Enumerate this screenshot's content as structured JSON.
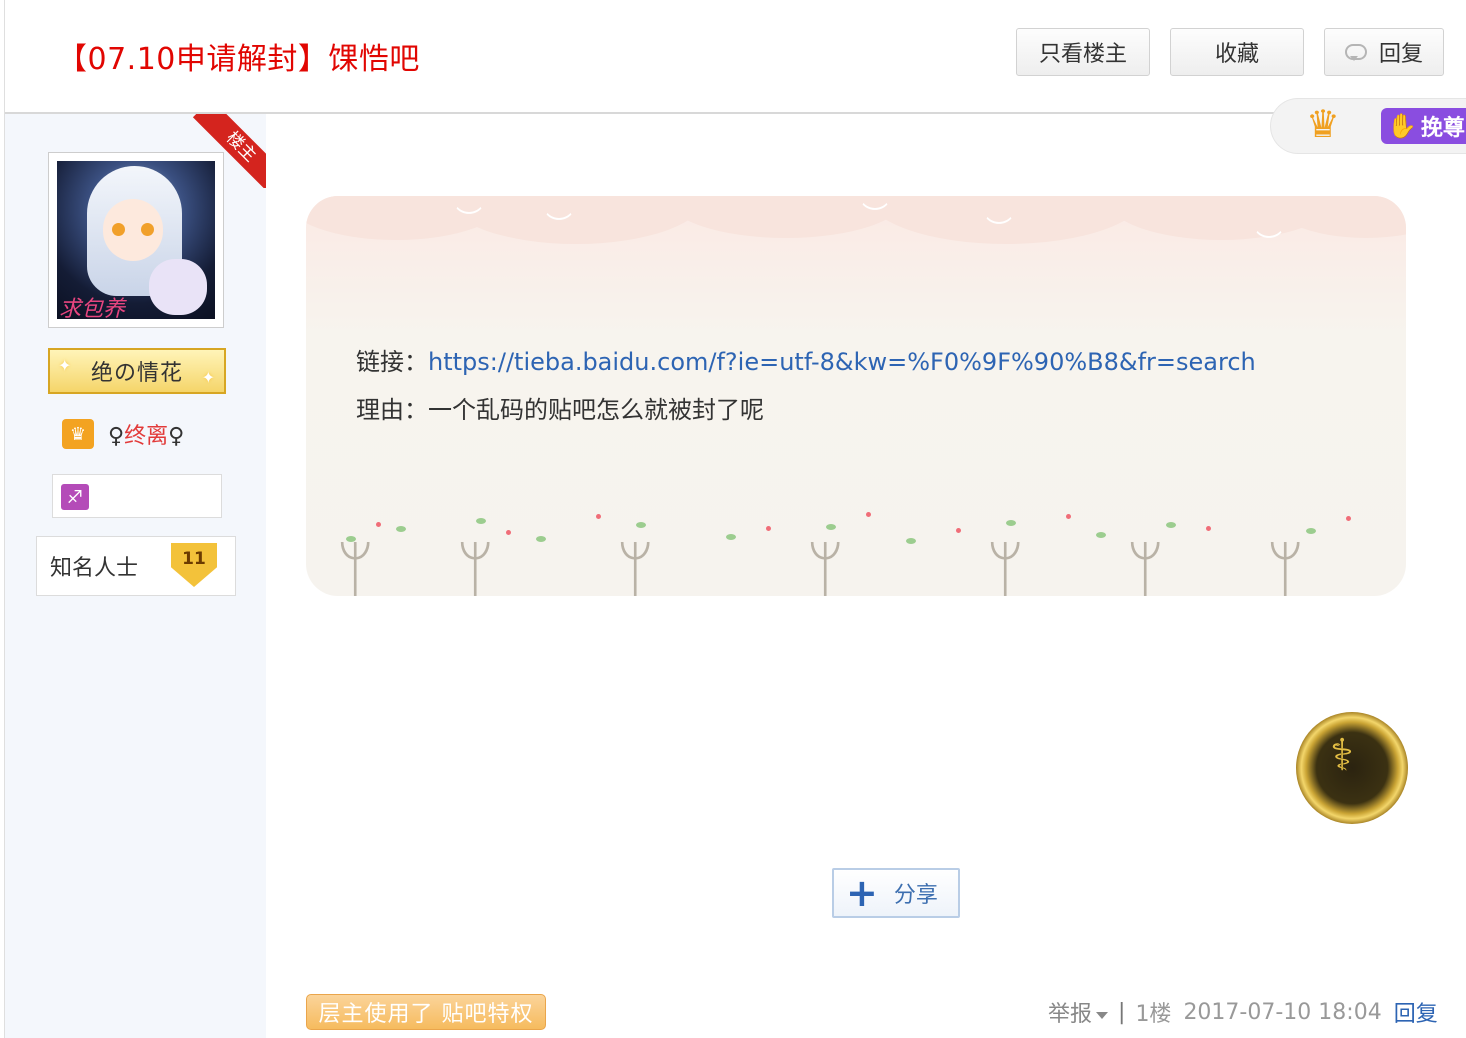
{
  "thread": {
    "title": "【07.10申请解封】馃悎吧"
  },
  "header_buttons": {
    "only_owner": "只看楼主",
    "favorite": "收藏",
    "reply": "回复"
  },
  "side_tag": {
    "label": "挽尊"
  },
  "user": {
    "owner_ribbon": "楼主",
    "avatar_caption": "求包养",
    "honor_title": "绝の情花",
    "name_prefix": "♀",
    "name": "终离",
    "name_suffix": "♀",
    "level_title": "知名人士",
    "level_number": "11"
  },
  "post": {
    "link_label": "链接：",
    "link_url": "https://tieba.baidu.com/f?ie=utf-8&kw=%F0%9F%90%B8&fr=search",
    "reason_label": "理由：",
    "reason_text": "一个乱码的贴吧怎么就被封了呢"
  },
  "share": {
    "label": "分享"
  },
  "privilege": {
    "label": "层主使用了 贴吧特权"
  },
  "tail": {
    "report": "举报",
    "separator": "|",
    "floor": "1楼",
    "datetime": "2017-07-10 18:04",
    "reply": "回复"
  },
  "colors": {
    "title_red": "#e10602",
    "link_blue": "#2d64b3",
    "side_panel": "#f4f7fc",
    "privilege_orange": "#f6bb5e",
    "tag_purple": "#8a4de0"
  },
  "icons": {
    "reply_button": "speech-bubble-icon",
    "crown": "crown-icon",
    "vip": "vip-crown-icon",
    "zodiac": "sagittarius-icon",
    "level": "shield-level-icon",
    "medal": "medal-icon",
    "share": "plus-icon",
    "report_dropdown": "caret-down-icon"
  }
}
